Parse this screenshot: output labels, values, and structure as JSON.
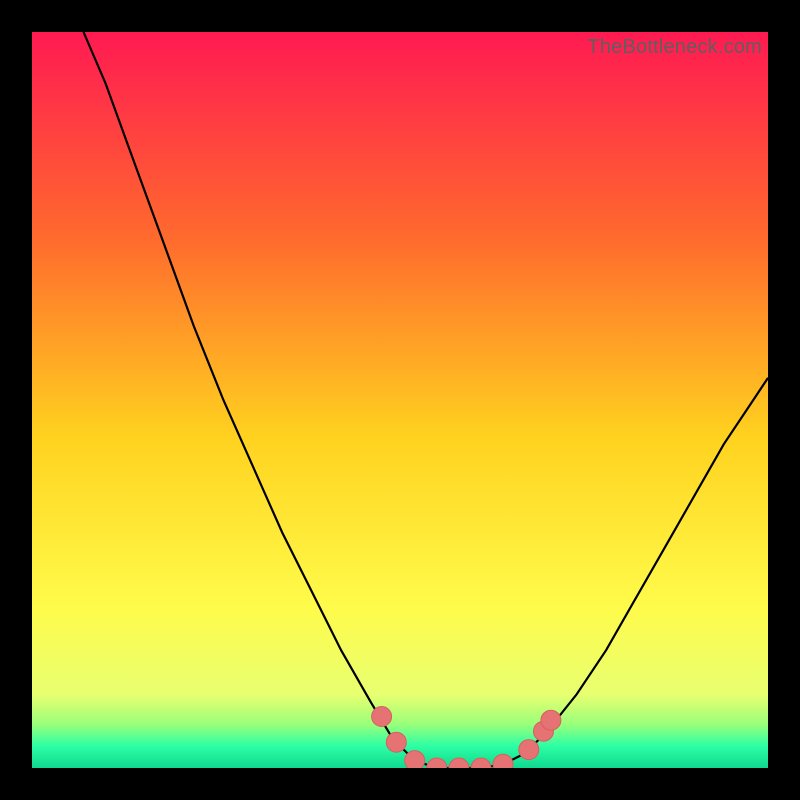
{
  "watermark": "TheBottleneck.com",
  "colors": {
    "frame_bg": "#000000",
    "curve": "#000000",
    "marker_fill": "#e57373",
    "marker_stroke": "#d85f5f",
    "grad_top": "#ff1a52",
    "grad_mid1": "#ff6a2d",
    "grad_mid2": "#ffd21f",
    "grad_mid3": "#fffb4a",
    "grad_low": "#e8ff70",
    "grad_green1": "#9bff7a",
    "grad_green2": "#2dffa4",
    "grad_bottom": "#10d990"
  },
  "chart_data": {
    "type": "line",
    "title": "",
    "xlabel": "",
    "ylabel": "",
    "xlim": [
      0,
      100
    ],
    "ylim": [
      0,
      100
    ],
    "grid": false,
    "curve_points": [
      {
        "x": 7,
        "y": 100
      },
      {
        "x": 10,
        "y": 93
      },
      {
        "x": 14,
        "y": 82
      },
      {
        "x": 18,
        "y": 71
      },
      {
        "x": 22,
        "y": 60
      },
      {
        "x": 26,
        "y": 50
      },
      {
        "x": 30,
        "y": 41
      },
      {
        "x": 34,
        "y": 32
      },
      {
        "x": 38,
        "y": 24
      },
      {
        "x": 42,
        "y": 16
      },
      {
        "x": 46,
        "y": 9
      },
      {
        "x": 49,
        "y": 4
      },
      {
        "x": 52,
        "y": 1
      },
      {
        "x": 55,
        "y": 0
      },
      {
        "x": 58,
        "y": 0
      },
      {
        "x": 61,
        "y": 0
      },
      {
        "x": 64,
        "y": 0.5
      },
      {
        "x": 67,
        "y": 2
      },
      {
        "x": 70,
        "y": 5
      },
      {
        "x": 74,
        "y": 10
      },
      {
        "x": 78,
        "y": 16
      },
      {
        "x": 82,
        "y": 23
      },
      {
        "x": 86,
        "y": 30
      },
      {
        "x": 90,
        "y": 37
      },
      {
        "x": 94,
        "y": 44
      },
      {
        "x": 98,
        "y": 50
      },
      {
        "x": 100,
        "y": 53
      }
    ],
    "markers": [
      {
        "x": 47.5,
        "y": 7
      },
      {
        "x": 49.5,
        "y": 3.5
      },
      {
        "x": 52,
        "y": 1
      },
      {
        "x": 55,
        "y": 0
      },
      {
        "x": 58,
        "y": 0
      },
      {
        "x": 61,
        "y": 0
      },
      {
        "x": 64,
        "y": 0.5
      },
      {
        "x": 67.5,
        "y": 2.5
      },
      {
        "x": 69.5,
        "y": 5
      },
      {
        "x": 70.5,
        "y": 6.5
      }
    ]
  }
}
